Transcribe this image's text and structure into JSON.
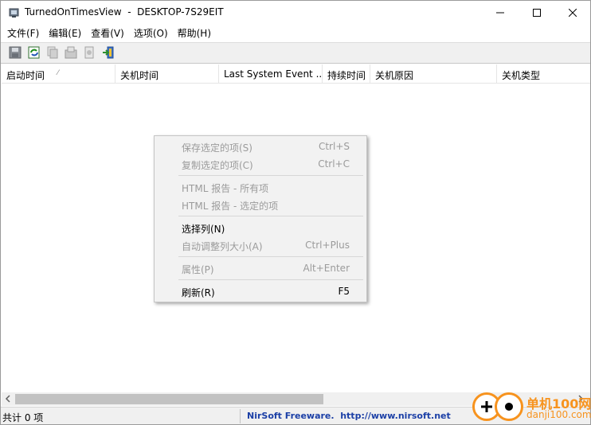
{
  "window": {
    "title": "TurnedOnTimesView  -  DESKTOP-7S29EIT"
  },
  "menubar": {
    "items": [
      "文件(F)",
      "编辑(E)",
      "查看(V)",
      "选项(O)",
      "帮助(H)"
    ]
  },
  "toolbar": {
    "icons": [
      "save-icon",
      "refresh-icon",
      "copy-icon",
      "properties-icon",
      "html-report-icon",
      "exit-icon"
    ]
  },
  "list": {
    "columns": [
      "启动时间",
      "关机时间",
      "Last System Event ...",
      "持续时间",
      "关机原因",
      "关机类型"
    ],
    "sort_indicator": "⁄"
  },
  "context_menu": {
    "items": [
      {
        "label": "保存选定的项(S)",
        "shortcut": "Ctrl+S"
      },
      {
        "label": "复制选定的项(C)",
        "shortcut": "Ctrl+C"
      },
      {
        "label": "HTML 报告 - 所有项",
        "shortcut": ""
      },
      {
        "label": "HTML 报告 - 选定的项",
        "shortcut": ""
      },
      {
        "label": "选择列(N)",
        "shortcut": ""
      },
      {
        "label": "自动调整列大小(A)",
        "shortcut": "Ctrl+Plus"
      },
      {
        "label": "属性(P)",
        "shortcut": "Alt+Enter"
      },
      {
        "label": "刷新(R)",
        "shortcut": "F5"
      }
    ]
  },
  "statusbar": {
    "count": "共计 0 项",
    "link": "NirSoft Freeware.  http://www.nirsoft.net"
  },
  "watermark": {
    "line1": "单机100网",
    "line2": "danji100.com"
  },
  "colors": {
    "link": "#1b3fa6",
    "watermark": "#f7931e",
    "disabled_text": "#9b9b9b"
  }
}
